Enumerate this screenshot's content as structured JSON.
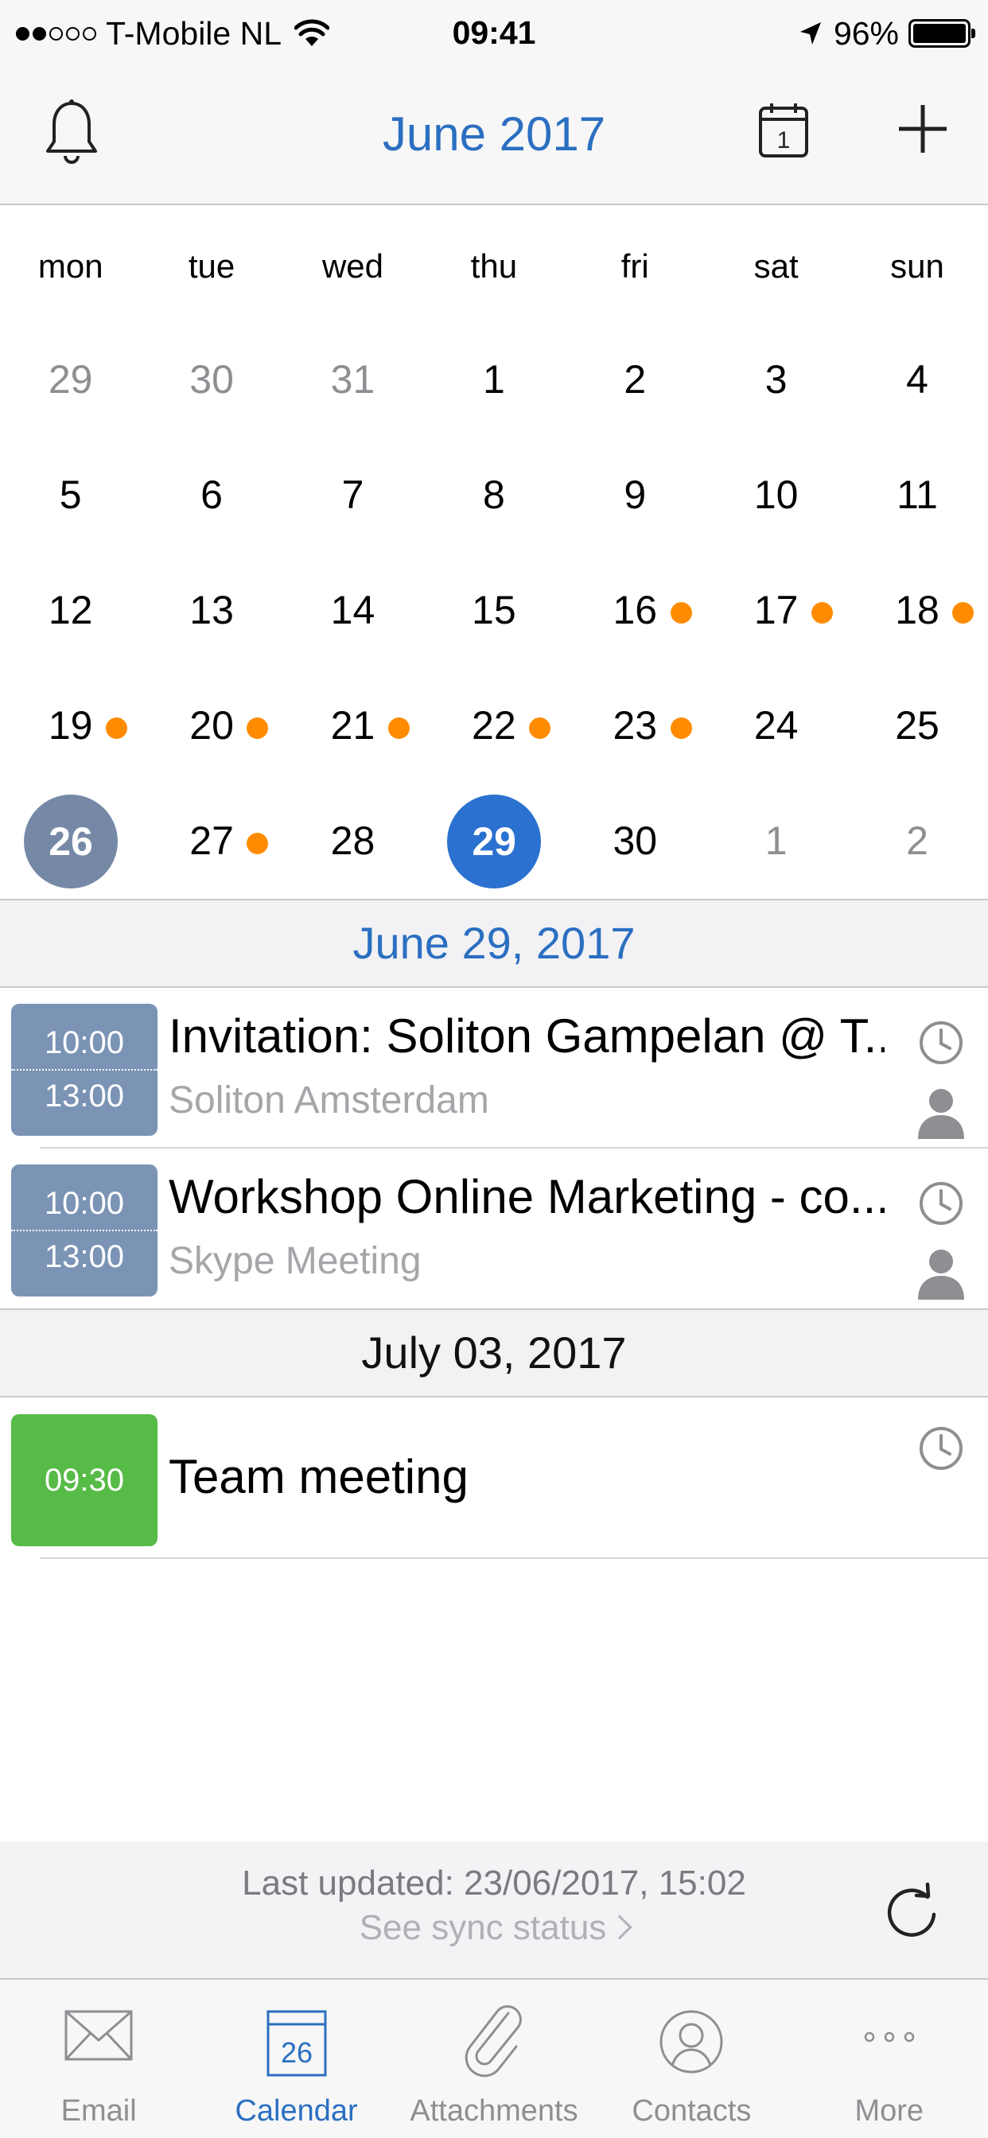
{
  "status_bar": {
    "carrier": "T-Mobile NL",
    "time": "09:41",
    "battery": "96%"
  },
  "nav": {
    "title": "June 2017",
    "today_icon_day": "1",
    "icons": [
      "bell-icon",
      "calendar-today-icon",
      "plus-icon"
    ]
  },
  "calendar": {
    "weekdays": [
      "mon",
      "tue",
      "wed",
      "thu",
      "fri",
      "sat",
      "sun"
    ],
    "weeks": [
      [
        {
          "day": "29",
          "muted": true,
          "dot": false
        },
        {
          "day": "30",
          "muted": true,
          "dot": false
        },
        {
          "day": "31",
          "muted": true,
          "dot": false
        },
        {
          "day": "1",
          "muted": false,
          "dot": false
        },
        {
          "day": "2",
          "muted": false,
          "dot": false
        },
        {
          "day": "3",
          "muted": false,
          "dot": false
        },
        {
          "day": "4",
          "muted": false,
          "dot": false
        }
      ],
      [
        {
          "day": "5",
          "muted": false,
          "dot": false
        },
        {
          "day": "6",
          "muted": false,
          "dot": false
        },
        {
          "day": "7",
          "muted": false,
          "dot": false
        },
        {
          "day": "8",
          "muted": false,
          "dot": false
        },
        {
          "day": "9",
          "muted": false,
          "dot": false
        },
        {
          "day": "10",
          "muted": false,
          "dot": false
        },
        {
          "day": "11",
          "muted": false,
          "dot": false
        }
      ],
      [
        {
          "day": "12",
          "muted": false,
          "dot": false
        },
        {
          "day": "13",
          "muted": false,
          "dot": false
        },
        {
          "day": "14",
          "muted": false,
          "dot": false
        },
        {
          "day": "15",
          "muted": false,
          "dot": false
        },
        {
          "day": "16",
          "muted": false,
          "dot": true
        },
        {
          "day": "17",
          "muted": false,
          "dot": true
        },
        {
          "day": "18",
          "muted": false,
          "dot": true
        }
      ],
      [
        {
          "day": "19",
          "muted": false,
          "dot": true
        },
        {
          "day": "20",
          "muted": false,
          "dot": true
        },
        {
          "day": "21",
          "muted": false,
          "dot": true
        },
        {
          "day": "22",
          "muted": false,
          "dot": true
        },
        {
          "day": "23",
          "muted": false,
          "dot": true
        },
        {
          "day": "24",
          "muted": false,
          "dot": false
        },
        {
          "day": "25",
          "muted": false,
          "dot": false
        }
      ],
      [
        {
          "day": "26",
          "muted": false,
          "dot": false,
          "state": "selected"
        },
        {
          "day": "27",
          "muted": false,
          "dot": true
        },
        {
          "day": "28",
          "muted": false,
          "dot": false
        },
        {
          "day": "29",
          "muted": false,
          "dot": false,
          "state": "today"
        },
        {
          "day": "30",
          "muted": false,
          "dot": false
        },
        {
          "day": "1",
          "muted": true,
          "dot": false
        },
        {
          "day": "2",
          "muted": true,
          "dot": false
        }
      ]
    ],
    "colors": {
      "accent": "#2b6fc1",
      "event_dot": "#ff8c00",
      "selected": "#7589a7",
      "today": "#2b71cf"
    }
  },
  "agenda": {
    "sections": [
      {
        "date": "June 29, 2017",
        "events": [
          {
            "start": "10:00",
            "end": "13:00",
            "title": "Invitation: Soliton Gampelan @ T...",
            "location": "Soliton Amsterdam",
            "color": "#7b94b5"
          },
          {
            "start": "10:00",
            "end": "13:00",
            "title": "Workshop Online Marketing - co...",
            "location": "Skype Meeting",
            "color": "#7b94b5"
          }
        ]
      },
      {
        "date": "July 03, 2017",
        "events": [
          {
            "start": "09:30",
            "title": "Team meeting",
            "color": "#57bb47"
          }
        ]
      }
    ]
  },
  "footer": {
    "last_updated": "Last updated: 23/06/2017, 15:02",
    "sync_status": "See sync status"
  },
  "tabbar": {
    "tabs": [
      {
        "label": "Email",
        "icon": "envelope-icon"
      },
      {
        "label": "Calendar",
        "icon": "calendar-icon",
        "icon_day": "26",
        "active": true
      },
      {
        "label": "Attachments",
        "icon": "paperclip-icon"
      },
      {
        "label": "Contacts",
        "icon": "contact-icon"
      },
      {
        "label": "More",
        "icon": "more-dots-icon"
      }
    ]
  }
}
